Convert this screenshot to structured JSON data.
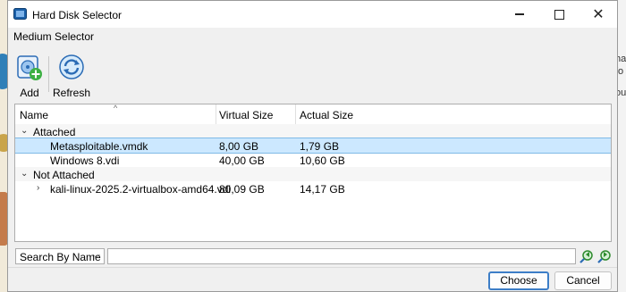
{
  "window": {
    "title": "Hard Disk Selector",
    "subtitle": "Medium Selector",
    "icon": "virtualbox-icon"
  },
  "toolbar": {
    "add_label": "Add",
    "refresh_label": "Refresh"
  },
  "table": {
    "columns": [
      "Name",
      "Virtual Size",
      "Actual Size"
    ],
    "groups": [
      {
        "label": "Attached",
        "expanded": true,
        "items": [
          {
            "name": "Metasploitable.vmdk",
            "virtual_size": "8,00 GB",
            "actual_size": "1,79 GB",
            "selected": true
          },
          {
            "name": "Windows 8.vdi",
            "virtual_size": "40,00 GB",
            "actual_size": "10,60 GB",
            "selected": false
          }
        ]
      },
      {
        "label": "Not Attached",
        "expanded": true,
        "items": [
          {
            "name": "kali-linux-2025.2-virtualbox-amd64.vdi",
            "virtual_size": "80,09 GB",
            "actual_size": "14,17 GB",
            "selected": false
          }
        ]
      }
    ]
  },
  "search": {
    "mode": "Search By Name",
    "value": ""
  },
  "buttons": {
    "choose": "Choose",
    "cancel": "Cancel"
  },
  "background": {
    "right_letters": [
      "ha",
      "fo",
      "ou"
    ]
  },
  "colors": {
    "selection": "#cce8ff",
    "default_button_border": "#3d7ec7"
  }
}
